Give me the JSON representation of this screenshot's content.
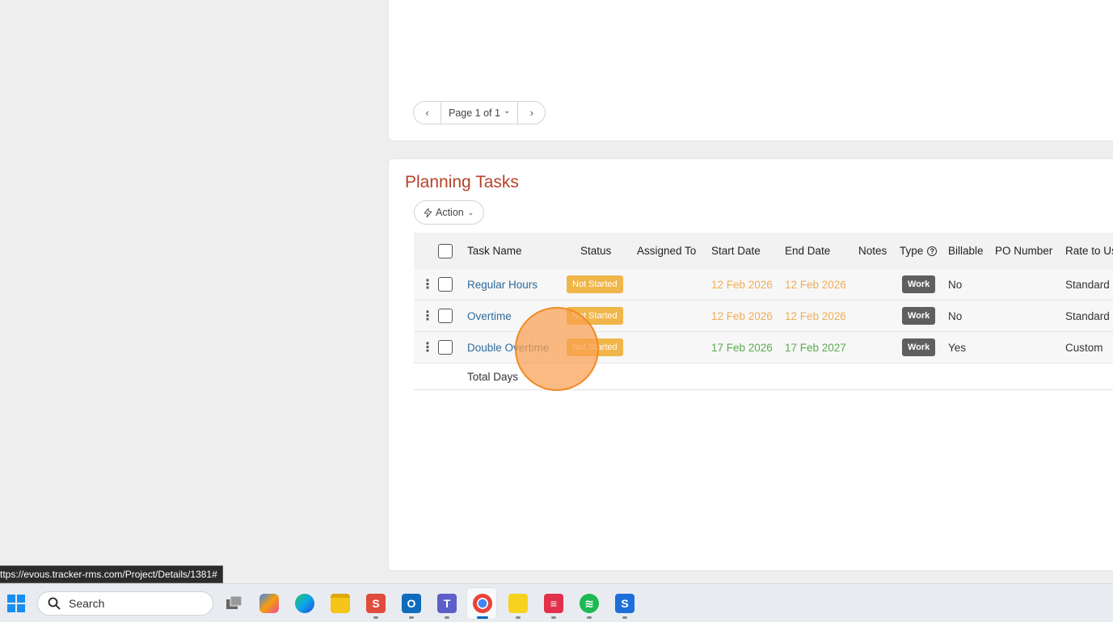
{
  "pager": {
    "prev": "‹",
    "label": "Page 1 of 1",
    "caret": "⌄",
    "next": "›"
  },
  "section": {
    "title": "Planning Tasks",
    "action_label": "Action"
  },
  "table": {
    "headers": {
      "task_name": "Task Name",
      "status": "Status",
      "assigned_to": "Assigned To",
      "start_date": "Start Date",
      "end_date": "End Date",
      "notes": "Notes",
      "type": "Type",
      "billable": "Billable",
      "po_number": "PO Number",
      "rate": "Rate to Us"
    },
    "rows": [
      {
        "task_name": "Regular Hours",
        "status": "Not Started",
        "start_date": "12 Feb 2026",
        "end_date": "12 Feb 2026",
        "type": "Work",
        "billable": "No",
        "rate": "Standard"
      },
      {
        "task_name": "Overtime",
        "status": "Not Started",
        "start_date": "12 Feb 2026",
        "end_date": "12 Feb 2026",
        "type": "Work",
        "billable": "No",
        "rate": "Standard"
      },
      {
        "task_name": "Double Overtime",
        "status": "Not Started",
        "start_date": "17 Feb 2026",
        "end_date": "17 Feb 2027",
        "type": "Work",
        "billable": "Yes",
        "rate": "Custom"
      }
    ],
    "total_label": "Total Days"
  },
  "colors": {
    "title": "#b5432a",
    "status_badge": "#f0b64a",
    "date_orange": "#f0ad55",
    "date_green": "#5cab4f",
    "link": "#2f6b9a"
  },
  "status_bar": {
    "url": "ttps://evous.tracker-rms.com/Project/Details/1381#"
  },
  "taskbar": {
    "search_placeholder": "Search"
  }
}
